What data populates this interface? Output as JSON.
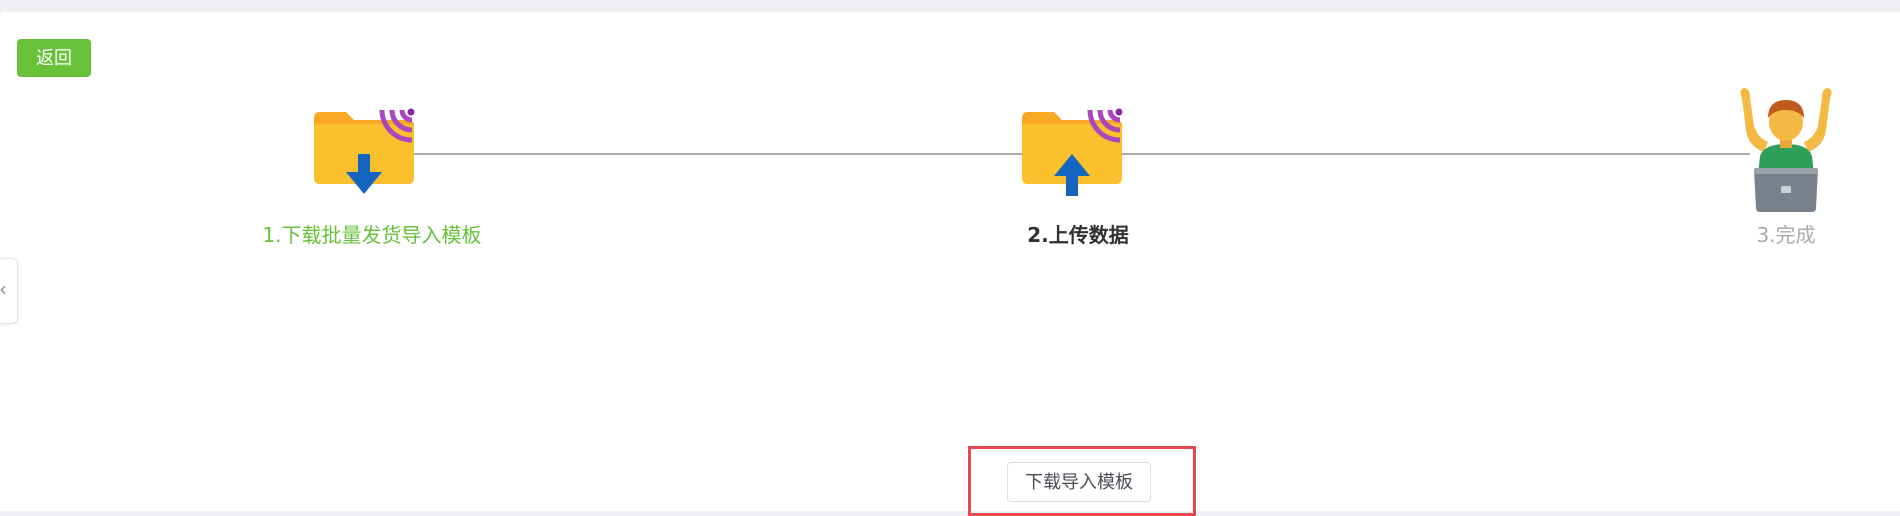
{
  "header": {
    "back_label": "返回"
  },
  "steps": [
    {
      "label": "1.下载批量发货导入模板",
      "icon": "folder-download-icon",
      "state": "done",
      "color": "#67c23a"
    },
    {
      "label": "2.上传数据",
      "icon": "folder-upload-icon",
      "state": "current",
      "color": "#303133"
    },
    {
      "label": "3.完成",
      "icon": "person-laptop-celebrate-icon",
      "state": "pending",
      "color": "#a8abb2"
    }
  ],
  "actions": {
    "download_template_label": "下载导入模板"
  },
  "sidebar": {
    "collapse_glyph": "‹"
  },
  "colors": {
    "accent_green": "#67c23a",
    "connector": "#a9abb5",
    "folder": "#fbc02d",
    "arrow": "#1565c0",
    "wifi": "#9c27b0",
    "highlight": "#e5484d"
  }
}
